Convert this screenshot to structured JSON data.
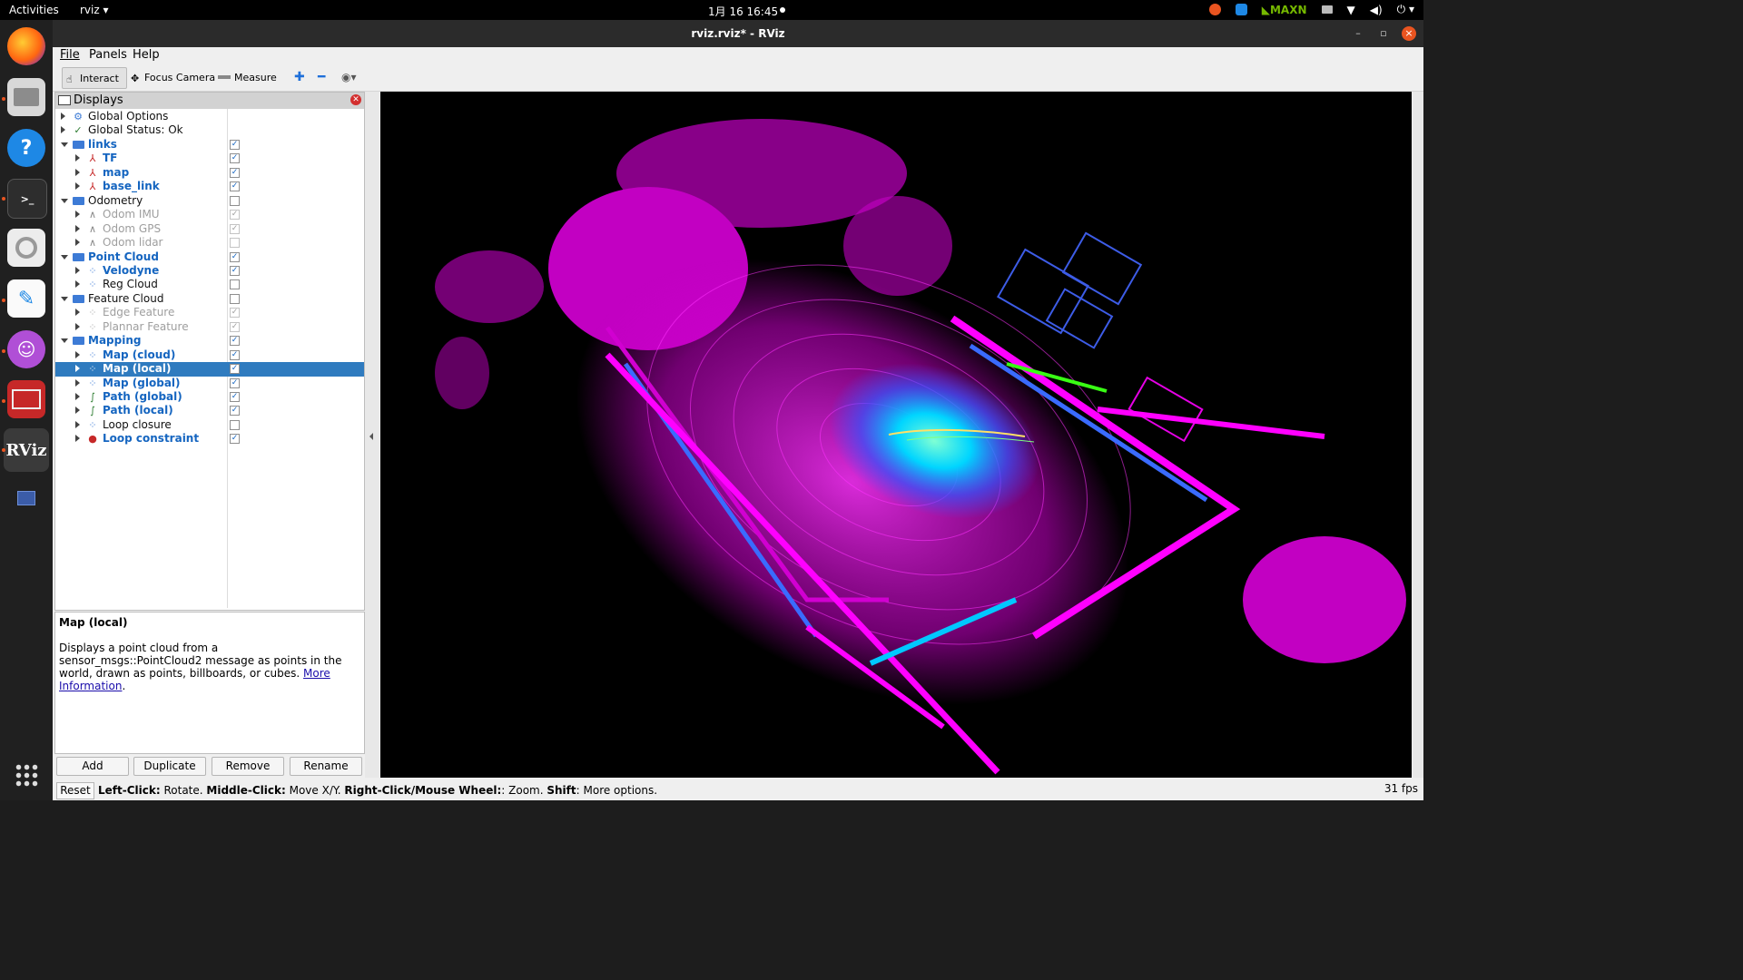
{
  "topbar": {
    "activities": "Activities",
    "app_menu": "rviz ▾",
    "clock": "1月 16  16:45",
    "gpu_mode": "MAXN"
  },
  "dock": {
    "items": [
      "firefox-icon",
      "files-icon",
      "help-icon",
      "terminal-icon",
      "settings-icon",
      "text-editor-icon",
      "cat-app-icon",
      "slides-icon",
      "rviz-icon",
      "window-icon"
    ],
    "rviz_label": "RViz"
  },
  "window": {
    "title": "rviz.rviz* - RViz",
    "controls": {
      "minimize": "–",
      "maximize": "▫",
      "close": "×"
    }
  },
  "menubar": [
    "File",
    "Panels",
    "Help"
  ],
  "toolbar": {
    "interact": "Interact",
    "focus_camera": "Focus Camera",
    "measure": "Measure"
  },
  "displays": {
    "title": "Displays",
    "rows": [
      {
        "label": "Global Options",
        "style": "dark",
        "checked": null
      },
      {
        "label": "Global Status: Ok",
        "style": "dark",
        "checked": null
      },
      {
        "label": "links",
        "style": "blue",
        "checked": true
      },
      {
        "label": "TF",
        "style": "blue",
        "checked": true
      },
      {
        "label": "map",
        "style": "blue",
        "checked": true
      },
      {
        "label": "base_link",
        "style": "blue",
        "checked": true
      },
      {
        "label": "Odometry",
        "style": "dark",
        "checked": false
      },
      {
        "label": "Odom IMU",
        "style": "grey",
        "checked": true
      },
      {
        "label": "Odom GPS",
        "style": "grey",
        "checked": true
      },
      {
        "label": "Odom lidar",
        "style": "grey",
        "checked": false
      },
      {
        "label": "Point Cloud",
        "style": "blue",
        "checked": true
      },
      {
        "label": "Velodyne",
        "style": "blue",
        "checked": true
      },
      {
        "label": "Reg Cloud",
        "style": "dark",
        "checked": false
      },
      {
        "label": "Feature Cloud",
        "style": "dark",
        "checked": false
      },
      {
        "label": "Edge Feature",
        "style": "grey",
        "checked": true
      },
      {
        "label": "Plannar Feature",
        "style": "grey",
        "checked": true
      },
      {
        "label": "Mapping",
        "style": "blue",
        "checked": true
      },
      {
        "label": "Map (cloud)",
        "style": "blue",
        "checked": true
      },
      {
        "label": "Map (local)",
        "style": "blue",
        "checked": true,
        "selected": true
      },
      {
        "label": "Map (global)",
        "style": "blue",
        "checked": true
      },
      {
        "label": "Path (global)",
        "style": "blue",
        "checked": true
      },
      {
        "label": "Path (local)",
        "style": "blue",
        "checked": true
      },
      {
        "label": "Loop closure",
        "style": "dark",
        "checked": false
      },
      {
        "label": "Loop constraint",
        "style": "blue",
        "checked": true
      }
    ]
  },
  "description": {
    "title": "Map (local)",
    "text": "Displays a point cloud from a sensor_msgs::PointCloud2 message as points in the world, drawn as points, billboards, or cubes. ",
    "link": "More Information",
    "link_suffix": "."
  },
  "buttons": {
    "add": "Add",
    "duplicate": "Duplicate",
    "remove": "Remove",
    "rename": "Rename"
  },
  "status": {
    "reset": "Reset",
    "left_click_key": "Left-Click:",
    "left_click_val": " Rotate. ",
    "middle_click_key": "Middle-Click:",
    "middle_click_val": " Move X/Y. ",
    "right_click_key": "Right-Click/Mouse Wheel:",
    "right_click_val": ": Zoom. ",
    "shift_key": "Shift",
    "shift_val": ": More options.",
    "fps": "31 fps"
  },
  "colors": {
    "cloud_magenta": "#ff00ff",
    "cloud_cyan": "#00e5ff",
    "cloud_blue": "#2a5bff",
    "cloud_green": "#39ff14",
    "selection": "#2f7bbf",
    "ubuntu_orange": "#e95420"
  }
}
